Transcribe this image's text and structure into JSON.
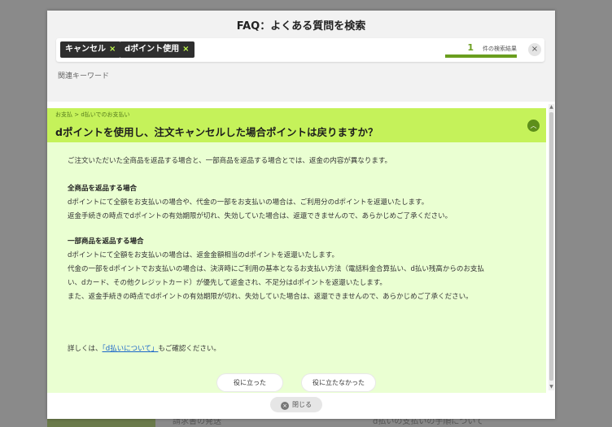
{
  "background": {
    "texts": [
      "請求書の発送",
      "d払いの支払いの手順について"
    ]
  },
  "modal": {
    "title": "FAQ：よくある質問を検索",
    "search": {
      "tags": [
        {
          "label": "キャンセル",
          "remove": "×"
        },
        {
          "label": "dポイント使用",
          "remove": "×"
        }
      ],
      "result_count": "1",
      "result_label": "件の検索結果",
      "clear_icon": "×"
    },
    "related_keywords_label": "関連キーワード",
    "faq": {
      "breadcrumb": "お支払 > d払いでのお支払い",
      "question": "dポイントを使用し、注文キャンセルした場合ポイントは戻りますか？",
      "collapse_icon": "︿",
      "answer": {
        "intro": "ご注文いただいた全商品を返品する場合と、一部商品を返品する場合とでは、返金の内容が異なります。",
        "full_title": "全商品を返品する場合",
        "full_lines": [
          "dポイントにて全額をお支払いの場合や、代金の一部をお支払いの場合は、ご利用分のdポイントを返還いたします。",
          "返金手続きの時点でdポイントの有効期限が切れ、失効していた場合は、返還できませんので、あらかじめご了承ください。"
        ],
        "partial_title": "一部商品を返品する場合",
        "partial_lines": [
          "dポイントにて全額をお支払いの場合は、返金金額相当のdポイントを返還いたします。",
          "代金の一部をdポイントでお支払いの場合は、決済時にご利用の基本となるお支払い方法（電話料金合算払い、d払い残高からのお支払",
          "い、dカード、その他クレジットカード）が優先して返金され、不足分はdポイントを返還いたします。",
          "また、返金手続きの時点でdポイントの有効期限が切れ、失効していた場合は、返還できませんので、あらかじめご了承ください。"
        ],
        "detail_prefix": "詳しくは、",
        "detail_link": "「d払いについて」",
        "detail_suffix": "もご確認ください。"
      },
      "helpful_label": "役に立った",
      "not_helpful_label": "役に立たなかった"
    },
    "close_label": "閉じる",
    "close_icon": "×"
  }
}
